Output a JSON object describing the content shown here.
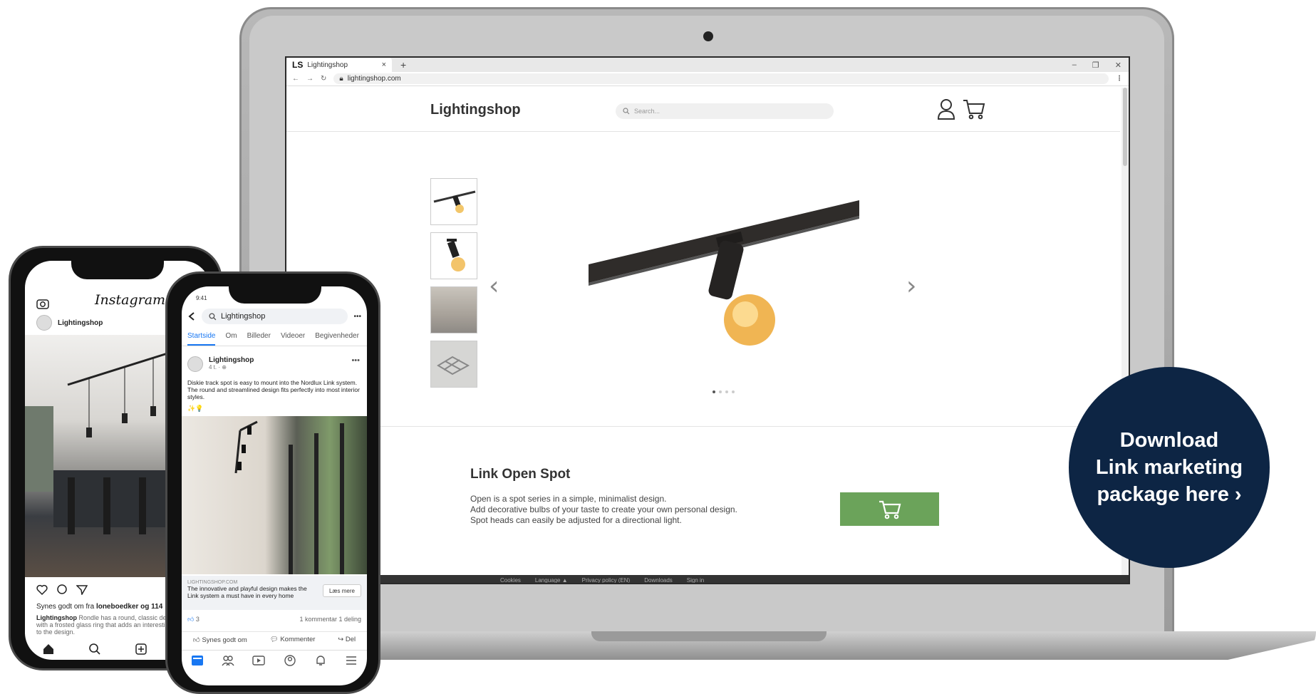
{
  "browser": {
    "tab_logo": "LS",
    "tab_title": "Lightingshop",
    "tab_close": "×",
    "new_tab": "+",
    "url": "lightingshop.com"
  },
  "site": {
    "brand": "Lightingshop",
    "search_placeholder": "Search...",
    "product": {
      "title": "Link Open Spot",
      "description_lines": [
        "Open is a spot series in a simple, minimalist design.",
        "Add decorative bulbs of your taste to create your own personal design.",
        "Spot heads can easily be adjusted for a directional light."
      ]
    },
    "footer_links": [
      "Cookies",
      "Language ▲",
      "Privacy policy (EN)",
      "Downloads",
      "Sign in"
    ]
  },
  "instagram": {
    "logo": "Instagram",
    "account": "Lightingshop",
    "likes_prefix": "Synes godt om fra ",
    "likes_user": "loneboedker",
    "likes_suffix": " og 114",
    "caption_user": "Lightingshop",
    "caption_text": " Rondle has a round, classic design with a frosted glass ring that adds an interesting light to the design."
  },
  "facebook": {
    "time": "9:41",
    "search": "Lightingshop",
    "more": "•••",
    "tabs": [
      "Startside",
      "Om",
      "Billeder",
      "Videoer",
      "Begivenheder"
    ],
    "page_name": "Lightingshop",
    "post_meta": "4 t. · ⊕",
    "post_text": "Diskie track spot is easy to mount into the Nordlux Link system. The round and streamlined design fits perfectly into most interior styles.",
    "emoji": "✨💡",
    "link_domain": "LIGHTINGSHOP.COM",
    "link_title": "The innovative and playful design makes the Link system a must have in every home",
    "link_button": "Læs mere",
    "reactions": "3",
    "comments_shares": "1 kommentar  1 deling",
    "actions": [
      "Synes godt om",
      "Kommenter",
      "Del"
    ]
  },
  "cta": {
    "lines": [
      "Download",
      "Link marketing",
      "package here ›"
    ]
  },
  "colors": {
    "cta_bg": "#0d2544",
    "cart_button": "#6ba35a",
    "fb_blue": "#1877f2"
  },
  "icons": [
    "search-icon",
    "user-icon",
    "cart-icon",
    "chevron-left-icon",
    "chevron-right-icon",
    "heart-icon",
    "comment-icon",
    "send-icon",
    "home-icon",
    "plus-icon",
    "camera-icon",
    "back-icon",
    "like-icon",
    "share-icon",
    "bell-icon",
    "menu-icon"
  ]
}
